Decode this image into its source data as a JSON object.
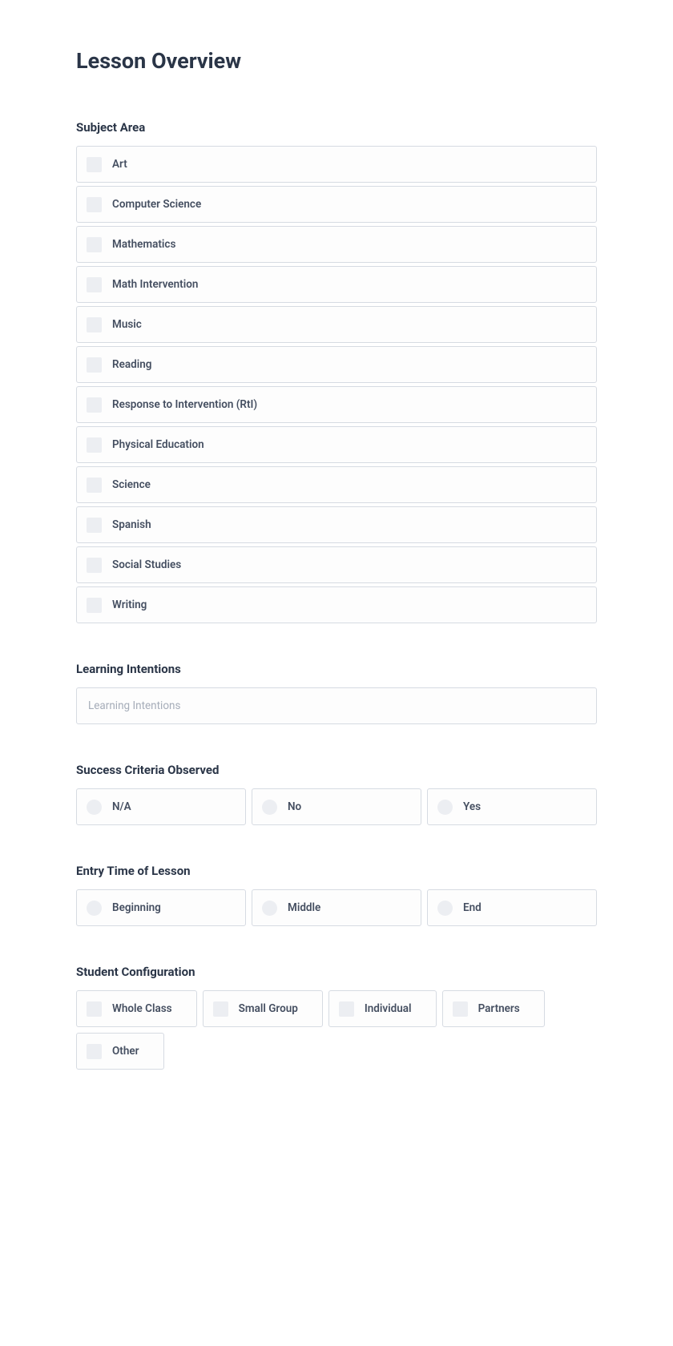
{
  "page_title": "Lesson Overview",
  "sections": {
    "subject_area": {
      "label": "Subject Area",
      "options": [
        "Art",
        "Computer Science",
        "Mathematics",
        "Math Intervention",
        "Music",
        "Reading",
        "Response to Intervention (RtI)",
        "Physical Education",
        "Science",
        "Spanish",
        "Social Studies",
        "Writing"
      ]
    },
    "learning_intentions": {
      "label": "Learning Intentions",
      "placeholder": "Learning Intentions"
    },
    "success_criteria": {
      "label": "Success Criteria Observed",
      "options": [
        "N/A",
        "No",
        "Yes"
      ]
    },
    "entry_time": {
      "label": "Entry Time of Lesson",
      "options": [
        "Beginning",
        "Middle",
        "End"
      ]
    },
    "student_config": {
      "label": "Student Configuration",
      "options": [
        "Whole Class",
        "Small Group",
        "Individual",
        "Partners",
        "Other"
      ]
    }
  }
}
